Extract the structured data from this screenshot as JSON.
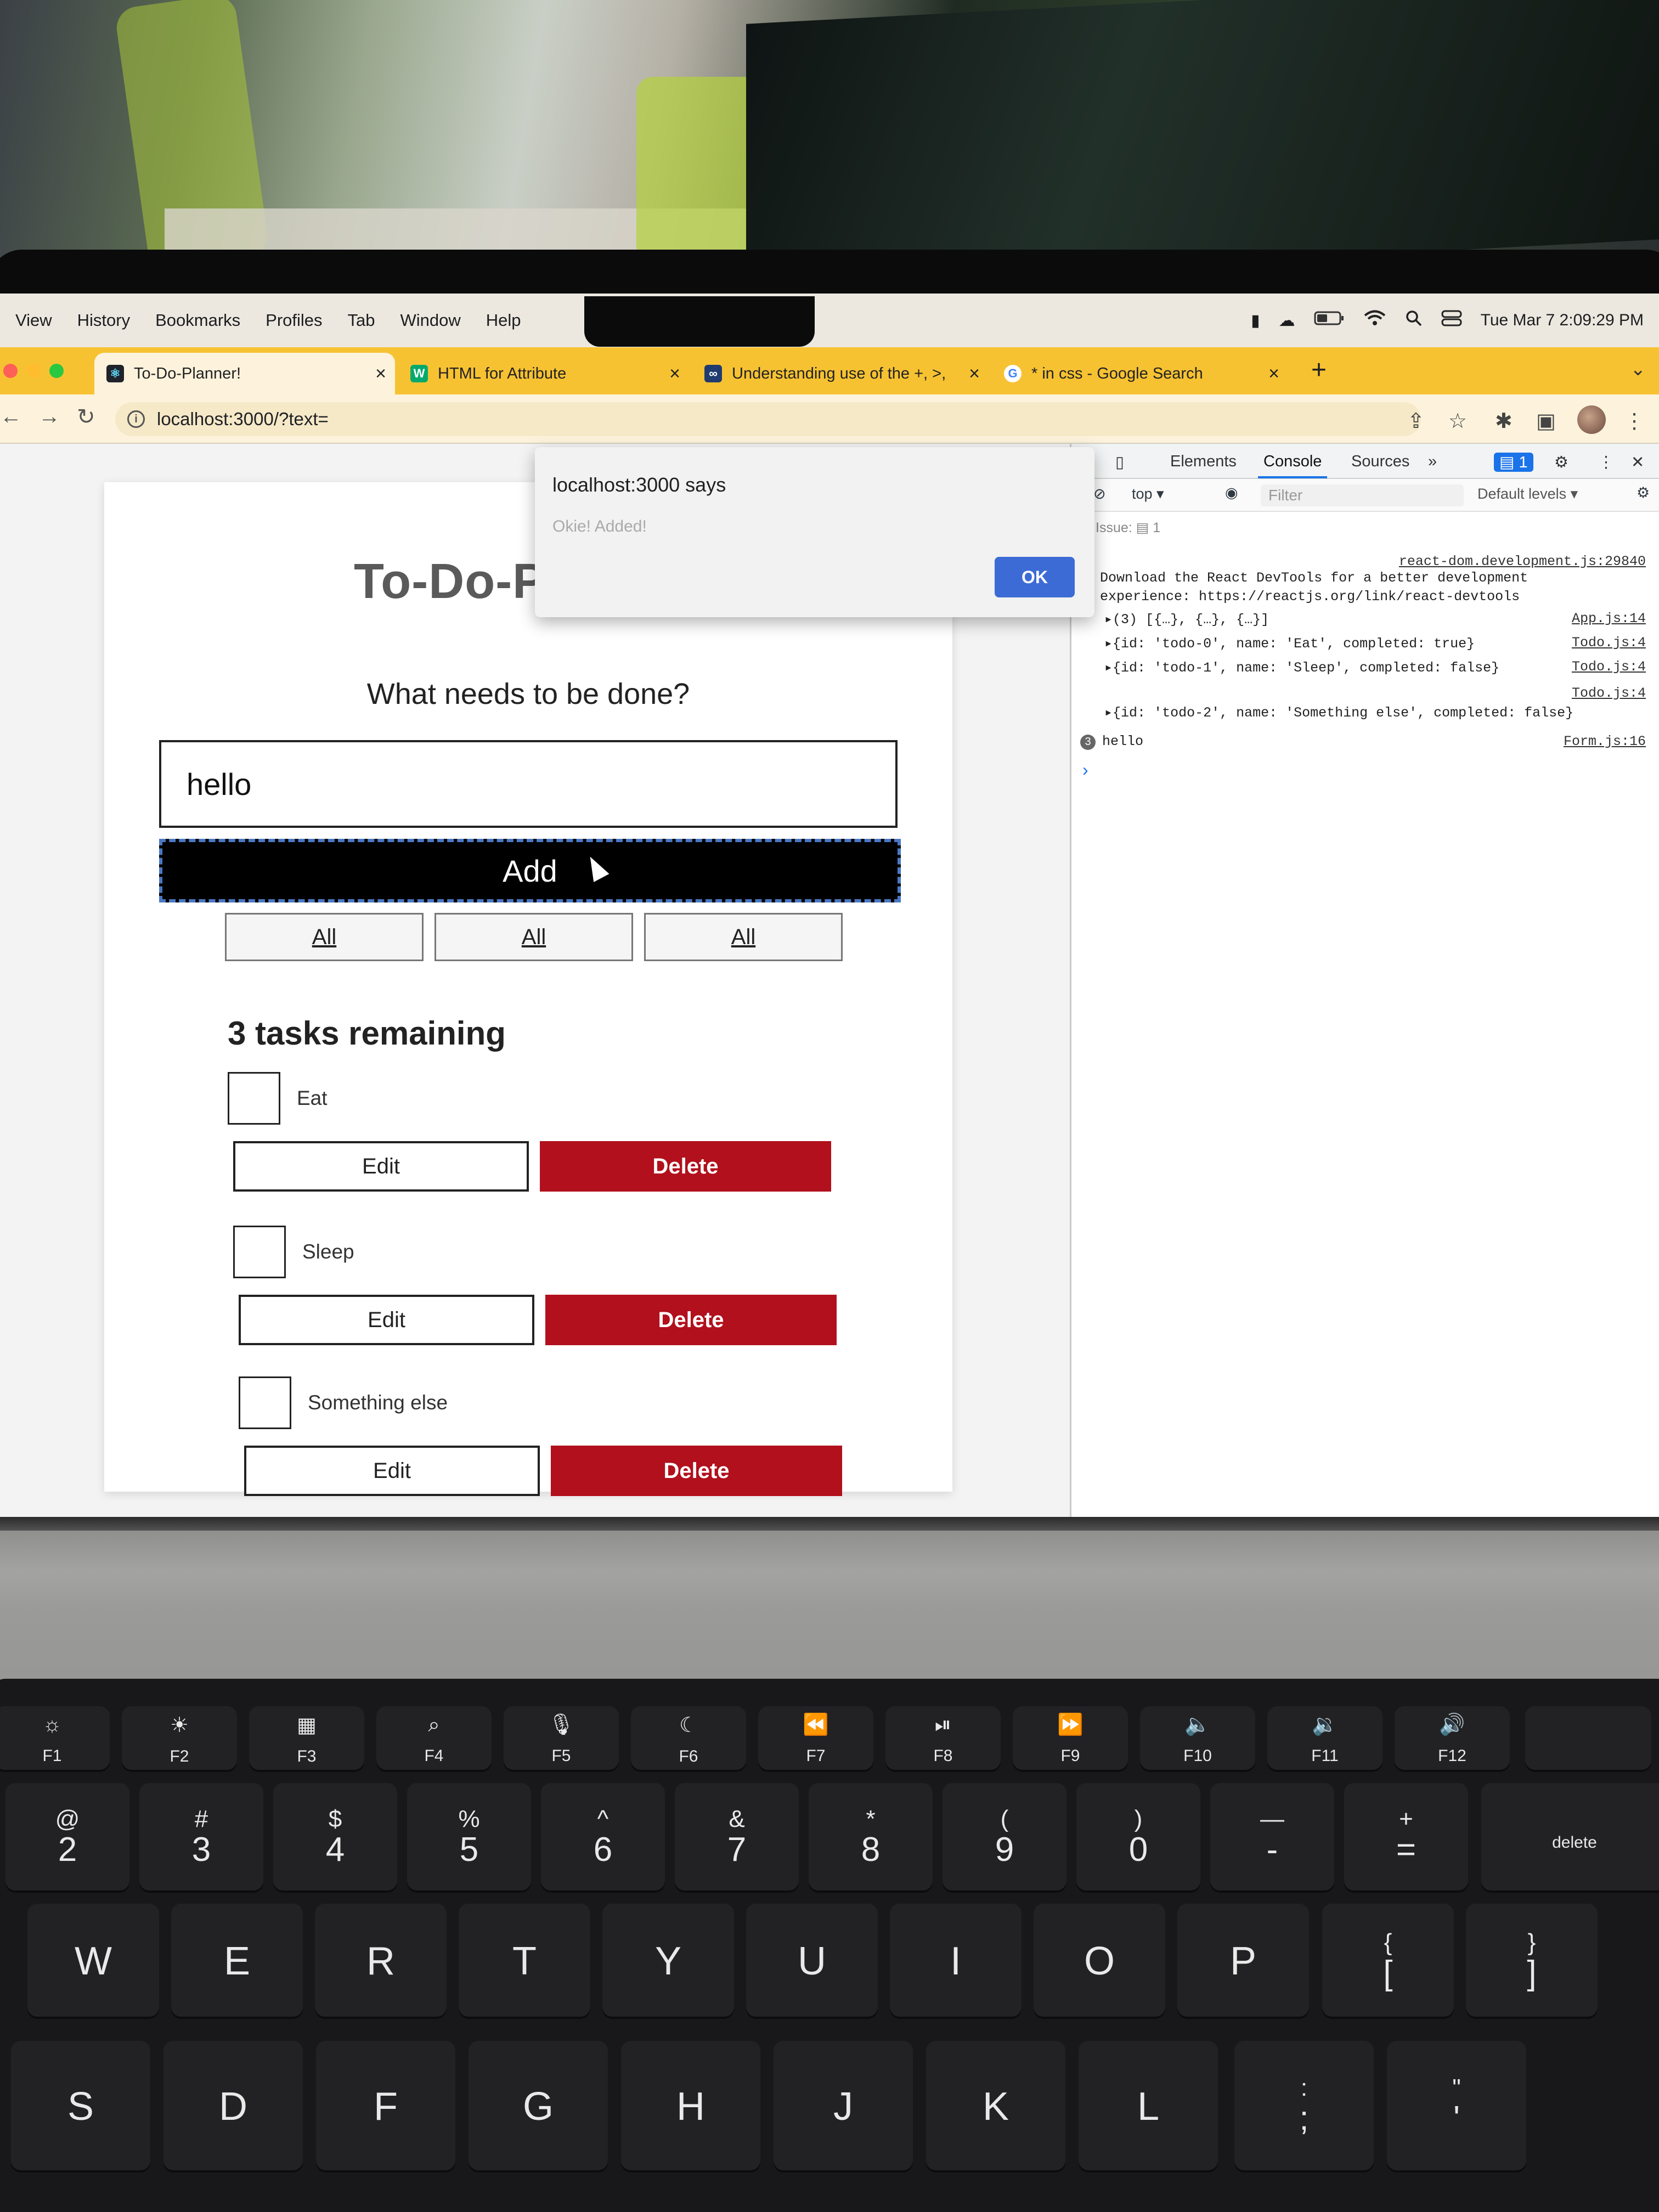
{
  "menubar": {
    "items": [
      "View",
      "History",
      "Bookmarks",
      "Profiles",
      "Tab",
      "Window",
      "Help"
    ],
    "datetime": "Tue Mar 7  2:09:29 PM"
  },
  "tabs": [
    {
      "title": "To-Do-Planner!",
      "favicon": "react-icon"
    },
    {
      "title": "HTML for Attribute",
      "favicon": "w3-icon"
    },
    {
      "title": "Understanding use of the +, >,",
      "favicon": "codepen-icon"
    },
    {
      "title": "* in css - Google Search",
      "favicon": "google-icon"
    }
  ],
  "browser": {
    "url": "localhost:3000/?text=",
    "accent": "#f7c232"
  },
  "app": {
    "title": "To-Do-P",
    "question": "What needs to be done?",
    "input_value": "hello",
    "add_label": "Add",
    "filters": [
      "All",
      "All",
      "All"
    ],
    "remaining": "3 tasks remaining",
    "todos": [
      {
        "name": "Eat",
        "edit_label": "Edit",
        "delete_label": "Delete",
        "completed": false
      },
      {
        "name": "Sleep",
        "edit_label": "Edit",
        "delete_label": "Delete",
        "completed": false
      },
      {
        "name": "Something else",
        "edit_label": "Edit",
        "delete_label": "Delete",
        "completed": false
      }
    ],
    "delete_color": "#b1101c"
  },
  "alert": {
    "origin": "localhost:3000 says",
    "message": "Okie! Added!",
    "ok_label": "OK"
  },
  "devtools": {
    "tabs": [
      "Elements",
      "Console",
      "Sources"
    ],
    "active_tab": "Console",
    "context": "top",
    "filter_placeholder": "Filter",
    "levels": "Default levels",
    "issues": "Issue:",
    "issues_count": "1",
    "badge_count": "1",
    "logs": [
      {
        "text": "Download the React DevTools for a better development",
        "source": "react-dom.development.js:29840"
      },
      {
        "text": "experience: https://reactjs.org/link/react-devtools",
        "source": ""
      },
      {
        "text": "▸(3) [{…}, {…}, {…}]",
        "source": "App.js:14"
      },
      {
        "text": "▸{id: 'todo-0', name: 'Eat', completed: true}",
        "source": "Todo.js:4"
      },
      {
        "text": "▸{id: 'todo-1', name: 'Sleep', completed: false}",
        "source": "Todo.js:4"
      },
      {
        "text": "",
        "source": "Todo.js:4"
      },
      {
        "text": "▸{id: 'todo-2', name: 'Something else', completed: false}",
        "source": ""
      },
      {
        "text": "hello",
        "source": "Form.js:16",
        "count": "3"
      }
    ]
  },
  "keyboard": {
    "fn_row": [
      "F1",
      "F2",
      "F3",
      "F4",
      "F5",
      "F6",
      "F7",
      "F8",
      "F9",
      "F10",
      "F11",
      "F12"
    ],
    "number_row": [
      {
        "top": "@",
        "bot": "2"
      },
      {
        "top": "#",
        "bot": "3"
      },
      {
        "top": "$",
        "bot": "4"
      },
      {
        "top": "%",
        "bot": "5"
      },
      {
        "top": "^",
        "bot": "6"
      },
      {
        "top": "&",
        "bot": "7"
      },
      {
        "top": "*",
        "bot": "8"
      },
      {
        "top": "(",
        "bot": "9"
      },
      {
        "top": ")",
        "bot": "0"
      },
      {
        "top": "—",
        "bot": "-"
      },
      {
        "top": "+",
        "bot": "="
      }
    ],
    "delete_label": "delete",
    "qwerty_row": [
      "W",
      "E",
      "R",
      "T",
      "Y",
      "U",
      "I",
      "O",
      "P"
    ],
    "bracket_keys": [
      {
        "top": "{",
        "bot": "["
      },
      {
        "top": "}",
        "bot": "]"
      }
    ],
    "home_row": [
      "S",
      "D",
      "F",
      "G",
      "H",
      "J",
      "K",
      "L"
    ],
    "punct_keys": [
      {
        "top": ":",
        "bot": ";"
      },
      {
        "top": "\"",
        "bot": "'"
      }
    ]
  }
}
